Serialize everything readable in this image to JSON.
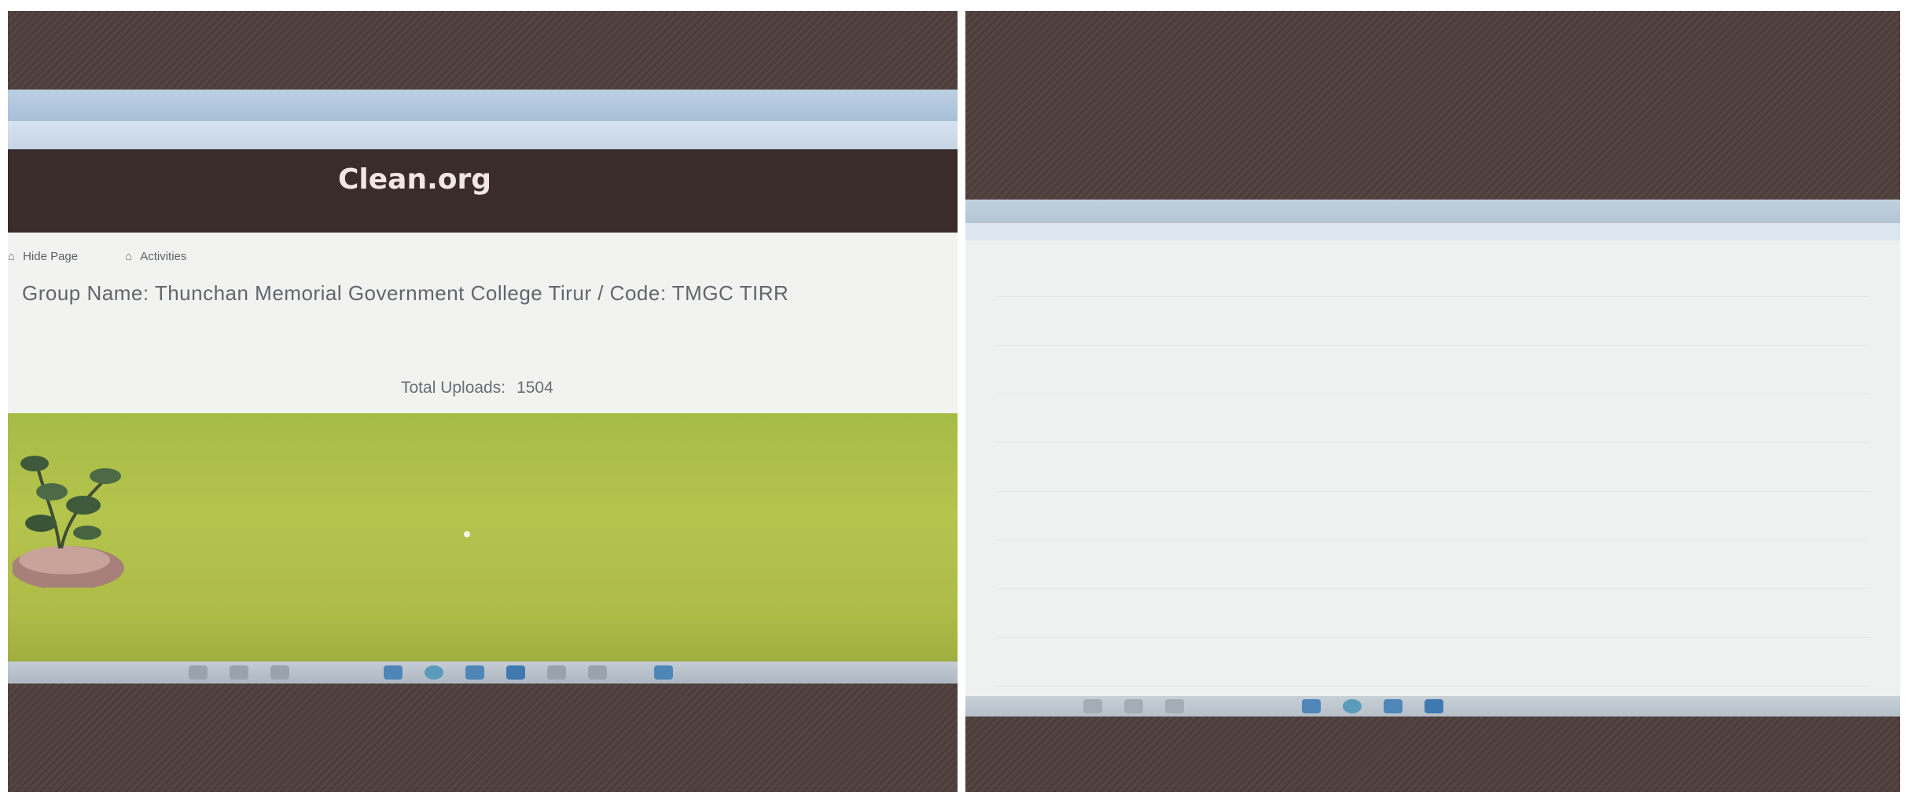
{
  "left_photo": {
    "website": {
      "logo": {
        "before": "",
        "main": "Clean",
        "mid": "",
        "end": ".org"
      },
      "subtoolbar": {
        "home_label": "Hide Page",
        "actions_label": "Activities"
      },
      "group_name": "Group Name: Thunchan Memorial Government College Tirur / Code: TMGC TIRR",
      "total_uploads_label": "Total Uploads:",
      "total_uploads_value": "1504"
    }
  },
  "colors": {
    "site_header": "#3a2c2b",
    "logo_accent": "#c9332c",
    "desktop_green": "#aebc47",
    "link_blue": "#7aa0c6"
  }
}
